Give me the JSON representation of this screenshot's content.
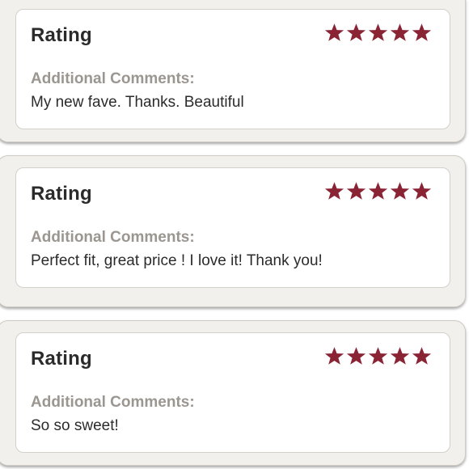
{
  "colors": {
    "star": "#8a2334",
    "card_background": "#f2f0ec",
    "label_gray": "#9b9690",
    "text_dark": "#2b2b2b"
  },
  "reviews": [
    {
      "rating_label": "Rating",
      "rating": 5,
      "max_rating": 5,
      "comments_label": "Additional Comments:",
      "comment": "My new fave. Thanks. Beautiful"
    },
    {
      "rating_label": "Rating",
      "rating": 5,
      "max_rating": 5,
      "comments_label": "Additional Comments:",
      "comment": "Perfect fit, great price ! I love it! Thank you!"
    },
    {
      "rating_label": "Rating",
      "rating": 5,
      "max_rating": 5,
      "comments_label": "Additional Comments:",
      "comment": "So so sweet!"
    }
  ]
}
